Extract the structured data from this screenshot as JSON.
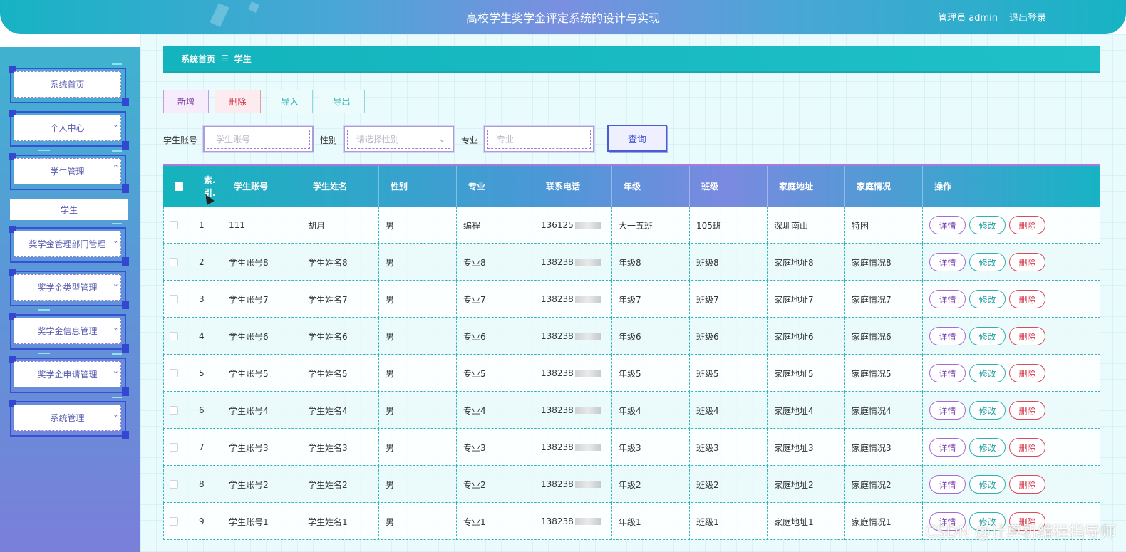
{
  "header": {
    "title": "高校学生奖学金评定系统的设计与实现",
    "user": "管理员 admin",
    "logout": "退出登录"
  },
  "sidebar": {
    "items": [
      {
        "label": "系统首页"
      },
      {
        "label": "个人中心"
      },
      {
        "label": "学生管理"
      },
      {
        "label": "奖学金管理部门管理"
      },
      {
        "label": "奖学金类型管理"
      },
      {
        "label": "奖学金信息管理"
      },
      {
        "label": "奖学金申请管理"
      },
      {
        "label": "系统管理"
      }
    ],
    "submenu_label": "学生"
  },
  "breadcrumb": {
    "home": "系统首页",
    "separator": "☰",
    "current": "学生"
  },
  "toolbar": {
    "add": "新增",
    "delete": "删除",
    "import": "导入",
    "export": "导出"
  },
  "search": {
    "account_label": "学生账号",
    "account_placeholder": "学生账号",
    "gender_label": "性别",
    "gender_placeholder": "请选择性别",
    "major_label": "专业",
    "major_placeholder": "专业",
    "query": "查询"
  },
  "table": {
    "headers": [
      "索引",
      "学生账号",
      "学生姓名",
      "性别",
      "专业",
      "联系电话",
      "年级",
      "班级",
      "家庭地址",
      "家庭情况",
      "操作"
    ],
    "index_header_top": "索.",
    "index_header_bottom": "引.",
    "actions": {
      "detail": "详情",
      "edit": "修改",
      "delete": "删除"
    },
    "rows": [
      {
        "index": "1",
        "account": "111",
        "name": "胡月",
        "gender": "男",
        "major": "编程",
        "phone": "136125",
        "grade": "大一五班",
        "class": "105班",
        "address": "深圳南山",
        "family": "特困"
      },
      {
        "index": "2",
        "account": "学生账号8",
        "name": "学生姓名8",
        "gender": "男",
        "major": "专业8",
        "phone": "138238",
        "grade": "年级8",
        "class": "班级8",
        "address": "家庭地址8",
        "family": "家庭情况8"
      },
      {
        "index": "3",
        "account": "学生账号7",
        "name": "学生姓名7",
        "gender": "男",
        "major": "专业7",
        "phone": "138238",
        "grade": "年级7",
        "class": "班级7",
        "address": "家庭地址7",
        "family": "家庭情况7"
      },
      {
        "index": "4",
        "account": "学生账号6",
        "name": "学生姓名6",
        "gender": "男",
        "major": "专业6",
        "phone": "138238",
        "grade": "年级6",
        "class": "班级6",
        "address": "家庭地址6",
        "family": "家庭情况6"
      },
      {
        "index": "5",
        "account": "学生账号5",
        "name": "学生姓名5",
        "gender": "男",
        "major": "专业5",
        "phone": "138238",
        "grade": "年级5",
        "class": "班级5",
        "address": "家庭地址5",
        "family": "家庭情况5"
      },
      {
        "index": "6",
        "account": "学生账号4",
        "name": "学生姓名4",
        "gender": "男",
        "major": "专业4",
        "phone": "138238",
        "grade": "年级4",
        "class": "班级4",
        "address": "家庭地址4",
        "family": "家庭情况4"
      },
      {
        "index": "7",
        "account": "学生账号3",
        "name": "学生姓名3",
        "gender": "男",
        "major": "专业3",
        "phone": "138238",
        "grade": "年级3",
        "class": "班级3",
        "address": "家庭地址3",
        "family": "家庭情况3"
      },
      {
        "index": "8",
        "account": "学生账号2",
        "name": "学生姓名2",
        "gender": "男",
        "major": "专业2",
        "phone": "138238",
        "grade": "年级2",
        "class": "班级2",
        "address": "家庭地址2",
        "family": "家庭情况2"
      },
      {
        "index": "9",
        "account": "学生账号1",
        "name": "学生姓名1",
        "gender": "男",
        "major": "专业1",
        "phone": "138238",
        "grade": "年级1",
        "class": "班级1",
        "address": "家庭地址1",
        "family": "家庭情况1"
      }
    ]
  },
  "watermark": "CSDN @计算机编程指导师",
  "colors": {
    "accent_teal": "#13b4bd",
    "accent_purple": "#7a8ae0",
    "sidebar_blue": "#3a4fd8",
    "detail": "#7b3fb3",
    "edit": "#1c9ea3",
    "delete": "#d0384a"
  }
}
